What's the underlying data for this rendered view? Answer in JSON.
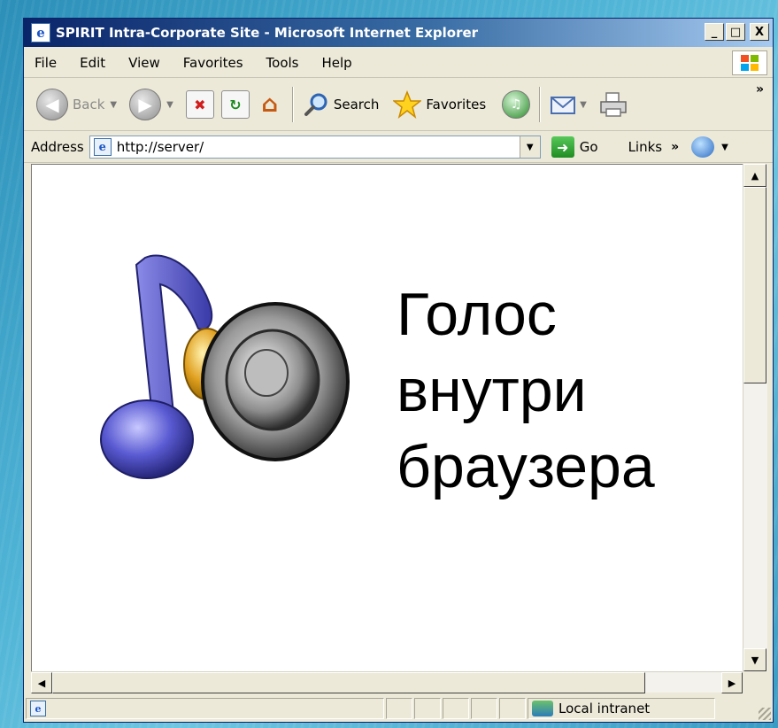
{
  "window": {
    "title": "SPIRIT Intra-Corporate Site - Microsoft Internet Explorer",
    "controls": {
      "minimize": "_",
      "maximize": "□",
      "close": "X"
    }
  },
  "menu": [
    "File",
    "Edit",
    "View",
    "Favorites",
    "Tools",
    "Help"
  ],
  "toolbar": {
    "back_label": "Back",
    "search_label": "Search",
    "favorites_label": "Favorites",
    "overflow": "»"
  },
  "address": {
    "label": "Address",
    "url": "http://server/",
    "go_label": "Go",
    "links_label": "Links",
    "links_overflow": "»"
  },
  "page": {
    "heading_lines": [
      "Голос",
      "внутри",
      "браузера"
    ]
  },
  "status": {
    "zone": "Local intranet"
  },
  "icons": {
    "window": "ie-icon",
    "back": "back-arrow-icon",
    "forward": "forward-arrow-icon",
    "stop": "stop-icon",
    "refresh": "refresh-icon",
    "home": "home-icon",
    "search": "search-icon",
    "favorites": "star-icon",
    "media": "media-icon",
    "mail": "mail-icon",
    "print": "printer-icon",
    "go": "go-arrow-icon",
    "zone": "intranet-icon",
    "art": "music-speaker-icon"
  },
  "colors": {
    "titlebar_start": "#0a246a",
    "titlebar_end": "#a6caf0",
    "note_blue": "#5050c8",
    "note_joint": "#e0a020"
  }
}
